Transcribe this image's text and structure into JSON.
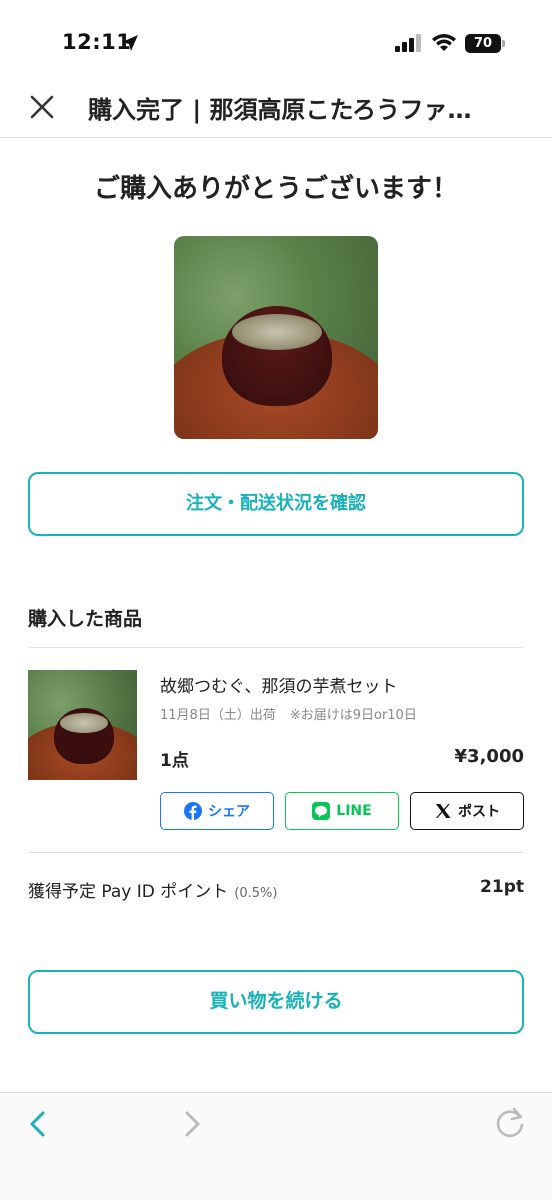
{
  "status_bar": {
    "time": "12:11",
    "battery": "70"
  },
  "header": {
    "title": "購入完了 | 那須高原こたろうファ…"
  },
  "thanks_message": "ご購入ありがとうございます！",
  "order_status_button": "注文・配送状況を確認",
  "purchased_section": {
    "title": "購入した商品",
    "product": {
      "name": "故郷つむぐ、那須の芋煮セット",
      "ship_date": "11月8日（土）出荷",
      "delivery_note": "※お届けは9日or10日",
      "quantity": "1点",
      "price": "¥3,000"
    },
    "share": {
      "facebook": "シェア",
      "line": "LINE",
      "x": "ポスト"
    }
  },
  "points": {
    "label": "獲得予定 Pay ID ポイント",
    "rate": "(0.5%)",
    "value": "21pt"
  },
  "continue_button": "買い物を続ける",
  "colors": {
    "accent": "#19b2b8",
    "facebook": "#1877f2",
    "line": "#06c755",
    "x": "#111111"
  },
  "icons": [
    "location-arrow-icon",
    "signal-icon",
    "wifi-icon",
    "battery-icon",
    "close-icon",
    "facebook-icon",
    "line-icon",
    "x-icon",
    "back-icon",
    "forward-icon",
    "reload-icon"
  ]
}
